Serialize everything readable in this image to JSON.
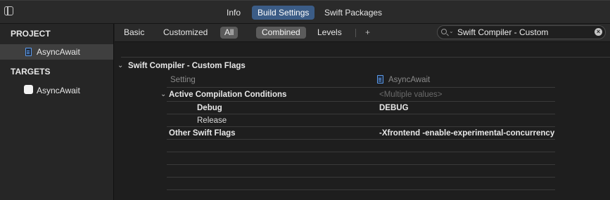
{
  "top_tabs": [
    {
      "label": "Info",
      "active": false
    },
    {
      "label": "Build Settings",
      "active": true
    },
    {
      "label": "Swift Packages",
      "active": false
    }
  ],
  "sidebar": {
    "project_header": "PROJECT",
    "project_item": "AsyncAwait",
    "targets_header": "TARGETS",
    "target_item": "AsyncAwait"
  },
  "filter": {
    "basic": "Basic",
    "customized": "Customized",
    "all": "All",
    "combined": "Combined",
    "levels": "Levels",
    "add": "+",
    "search_value": "Swift Compiler - Custom"
  },
  "section": {
    "title": "Swift Compiler - Custom Flags",
    "col_setting": "Setting",
    "col_target": "AsyncAwait",
    "rows": [
      {
        "name": "Active Compilation Conditions",
        "value": "<Multiple values>"
      },
      {
        "name": "Debug",
        "value": "DEBUG"
      },
      {
        "name": "Release",
        "value": ""
      },
      {
        "name": "Other Swift Flags",
        "value": "-Xfrontend -enable-experimental-concurrency"
      }
    ]
  },
  "colors": {
    "accent": "#3b5c86",
    "background": "#1e1e1e",
    "sidebar": "#262626"
  }
}
